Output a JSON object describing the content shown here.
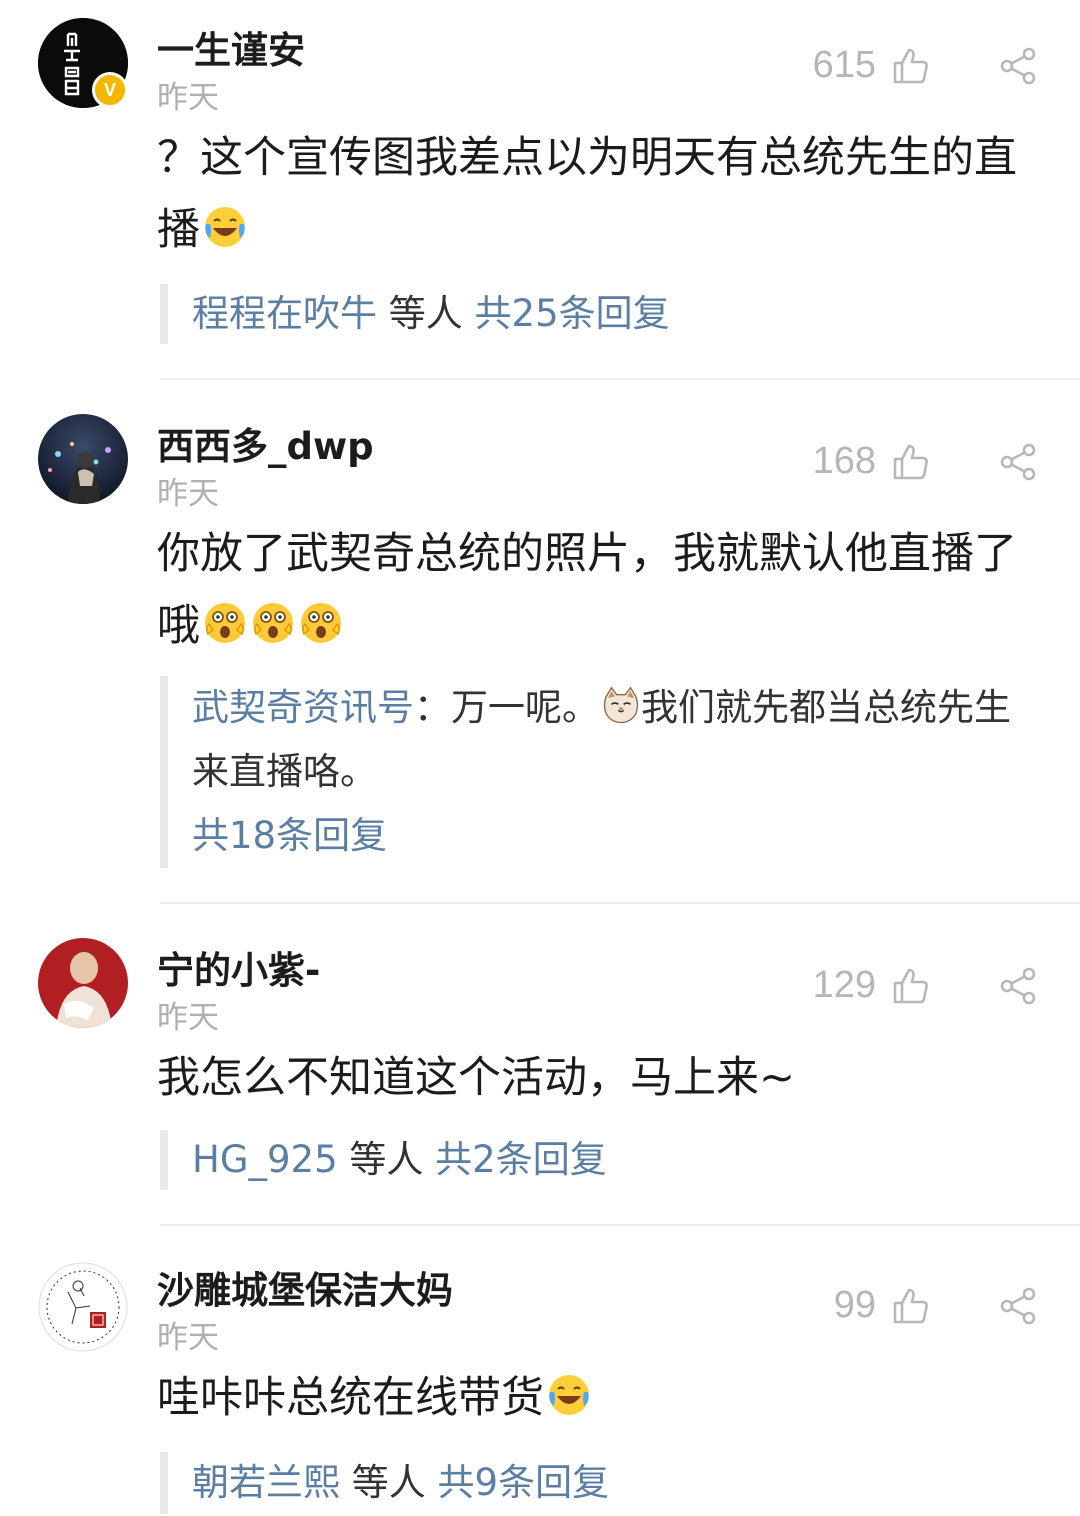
{
  "comments": [
    {
      "username": "一生谨安",
      "time": "昨天",
      "likes": "615",
      "text": "？这个宣传图我差点以为明天有总统先生的直播",
      "emojis": [
        "laugh-cry-emoji"
      ],
      "replies": {
        "names": "程程在吹牛",
        "suffix": "等人",
        "count": "共25条回复"
      }
    },
    {
      "username": "西西多_dwp",
      "time": "昨天",
      "likes": "168",
      "text": "你放了武契奇总统的照片，我就默认他直播了哦",
      "emojis": [
        "shocked-face-emoji",
        "shocked-face-emoji",
        "shocked-face-emoji"
      ],
      "replies": {
        "author": "武契奇资讯号",
        "colon": "：",
        "text_before": "万一呢。",
        "text_after": "我们就先都当总统先生来直播咯。",
        "count": "共18条回复"
      }
    },
    {
      "username": "宁的小紫-",
      "time": "昨天",
      "likes": "129",
      "text": "我怎么不知道这个活动，马上来~",
      "emojis": [],
      "replies": {
        "names": "HG_925",
        "suffix": "等人",
        "count": "共2条回复"
      }
    },
    {
      "username": "沙雕城堡保洁大妈",
      "time": "昨天",
      "likes": "99",
      "text": "哇咔咔总统在线带货",
      "emojis": [
        "laugh-cry-emoji"
      ],
      "replies": {
        "names": "朝若兰熙",
        "suffix": "等人",
        "count": "共9条回复"
      }
    }
  ],
  "icons": {
    "like": "thumbs-up-outline-icon",
    "share": "share-icon",
    "verified": "verified-badge-icon"
  },
  "colors": {
    "link": "#5b7ea5",
    "muted": "#b0b0b0",
    "badge": "#f5b800"
  },
  "badge_letter": "V"
}
